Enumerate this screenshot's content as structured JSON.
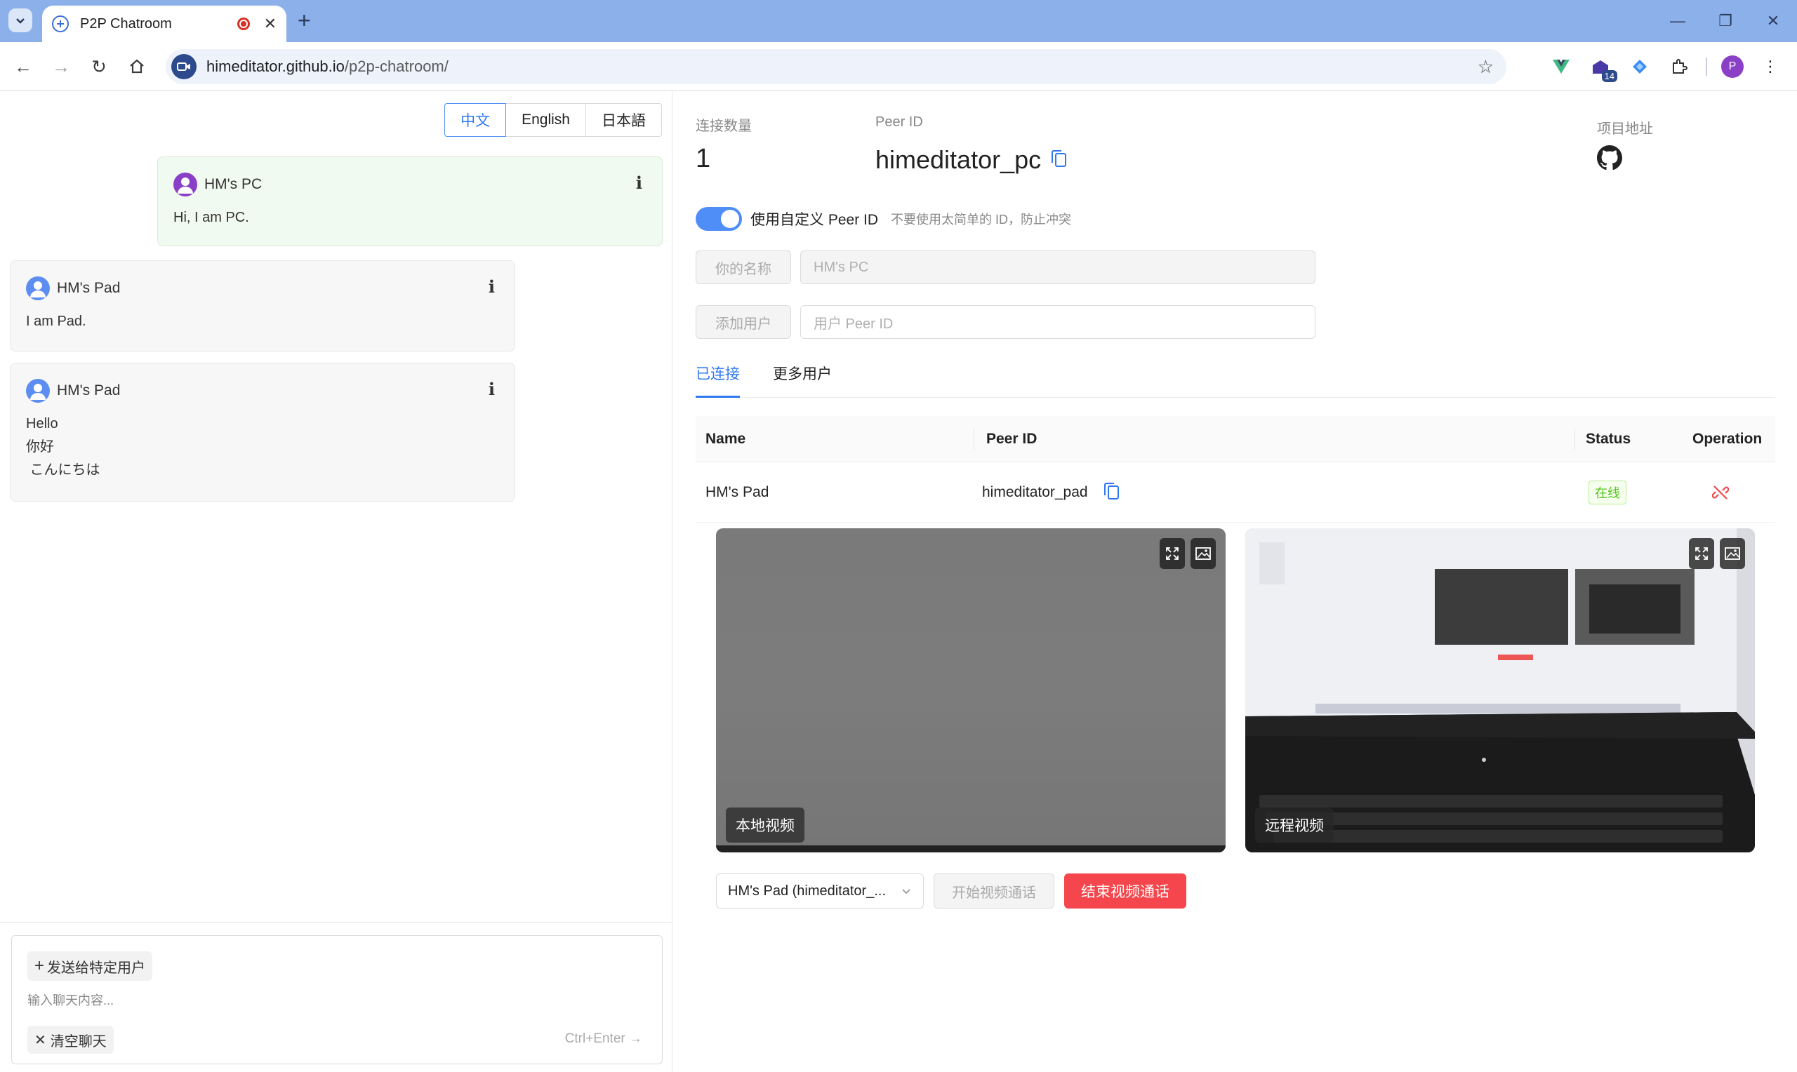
{
  "browser": {
    "tab_title": "P2P Chatroom",
    "url_host": "himeditator.github.io",
    "url_path": "/p2p-chatroom/",
    "ext_badge": "14",
    "profile_initial": "P"
  },
  "lang": {
    "zh": "中文",
    "en": "English",
    "ja": "日本語"
  },
  "messages": [
    {
      "name": "HM's PC",
      "text": "Hi, I am PC.",
      "mine": true,
      "avatar_color": "#8a3fc7"
    },
    {
      "name": "HM's Pad",
      "text": "I am Pad.",
      "mine": false,
      "avatar_color": "#5b8ef0"
    },
    {
      "name": "HM's Pad",
      "text": "Hello\n你好\n こんにちは",
      "mine": false,
      "avatar_color": "#5b8ef0"
    }
  ],
  "composer": {
    "send_to": "发送给特定用户",
    "placeholder": "输入聊天内容...",
    "clear": "清空聊天",
    "hint": "Ctrl+Enter"
  },
  "stats": {
    "conn_label": "连接数量",
    "conn_count": "1",
    "peer_label": "Peer ID",
    "peer_id": "himeditator_pc",
    "project_label": "项目地址"
  },
  "custom_id": {
    "label": "使用自定义 Peer ID",
    "hint": "不要使用太简单的 ID，防止冲突"
  },
  "form": {
    "name_btn": "你的名称",
    "name_value": "HM's PC",
    "add_btn": "添加用户",
    "peer_placeholder": "用户 Peer ID"
  },
  "tabs": {
    "connected": "已连接",
    "more": "更多用户"
  },
  "table": {
    "headers": {
      "name": "Name",
      "peer_id": "Peer ID",
      "status": "Status",
      "operation": "Operation"
    },
    "row": {
      "name": "HM's Pad",
      "peer_id": "himeditator_pad",
      "status": "在线"
    }
  },
  "video": {
    "local_label": "本地视频",
    "remote_label": "远程视频"
  },
  "call": {
    "selected_peer": "HM's Pad (himeditator_...",
    "start": "开始视频通话",
    "end": "结束视频通话"
  },
  "colors": {
    "accent": "#2f78f0",
    "danger": "#f4464c",
    "online": "#52c41a"
  }
}
